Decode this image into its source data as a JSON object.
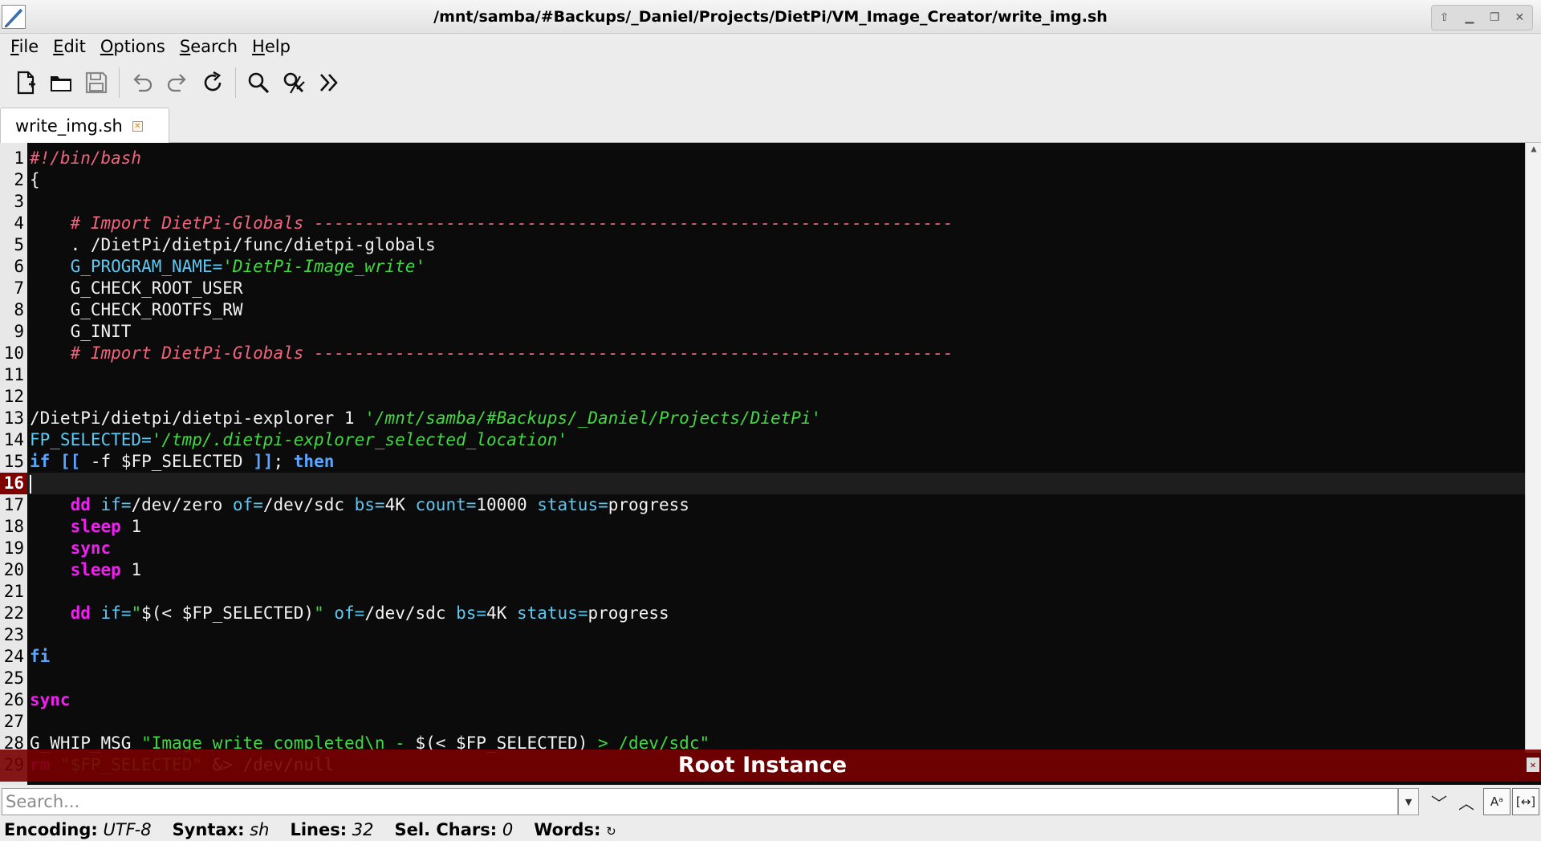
{
  "window": {
    "title": "/mnt/samba/#Backups/_Daniel/Projects/DietPi/VM_Image_Creator/write_img.sh",
    "controls": [
      "up-icon",
      "minimize-icon",
      "restore-icon",
      "close-icon"
    ]
  },
  "menu": [
    "File",
    "Edit",
    "Options",
    "Search",
    "Help"
  ],
  "toolbar": [
    "new-file-icon",
    "open-folder-icon",
    "save-icon",
    "undo-icon",
    "redo-icon",
    "reload-icon",
    "find-icon",
    "find-replace-icon",
    "goto-icon"
  ],
  "tab": {
    "label": "write_img.sh"
  },
  "editor": {
    "current_line": 16,
    "lines": [
      {
        "n": "1",
        "html": "<span class='cm'>#!/bin/bash</span>"
      },
      {
        "n": "2",
        "html": "{"
      },
      {
        "n": "3",
        "html": ""
      },
      {
        "n": "4",
        "html": "    <span class='cm'># Import DietPi-Globals ---------------------------------------------------------------</span>"
      },
      {
        "n": "5",
        "html": "    . /DietPi/dietpi/func/dietpi-globals"
      },
      {
        "n": "6",
        "html": "    <span class='vr'>G_PROGRAM_NAME=</span><span class='st'>'DietPi-Image_write'</span>"
      },
      {
        "n": "7",
        "html": "    G_CHECK_ROOT_USER"
      },
      {
        "n": "8",
        "html": "    G_CHECK_ROOTFS_RW"
      },
      {
        "n": "9",
        "html": "    G_INIT"
      },
      {
        "n": "10",
        "html": "    <span class='cm'># Import DietPi-Globals ---------------------------------------------------------------</span>"
      },
      {
        "n": "11",
        "html": ""
      },
      {
        "n": "12",
        "html": ""
      },
      {
        "n": "13",
        "html": "/DietPi/dietpi/dietpi-explorer 1 <span class='st'>'/mnt/samba/#Backups/_Daniel/Projects/DietPi'</span>"
      },
      {
        "n": "14",
        "html": "<span class='vr'>FP_SELECTED=</span><span class='st'>'/tmp/.dietpi-explorer_selected_location'</span>"
      },
      {
        "n": "15",
        "html": "<span class='kw'>if</span> <span class='kw'>[[</span> -f $FP_SELECTED <span class='kw'>]]</span>; <span class='kw'>then</span>"
      },
      {
        "n": "16",
        "html": "<span class='caret'></span>"
      },
      {
        "n": "17",
        "html": "    <span class='bi'>dd</span> <span class='vr'>if=</span>/dev/zero <span class='vr'>of=</span>/dev/sdc <span class='vr'>bs=</span>4K <span class='vr'>count=</span>10000 <span class='vr'>status=</span>progress"
      },
      {
        "n": "18",
        "html": "    <span class='bi'>sleep</span> 1"
      },
      {
        "n": "19",
        "html": "    <span class='bi'>sync</span>"
      },
      {
        "n": "20",
        "html": "    <span class='bi'>sleep</span> 1"
      },
      {
        "n": "21",
        "html": ""
      },
      {
        "n": "22",
        "html": "    <span class='bi'>dd</span> <span class='vr'>if=</span><span class='dq'>\"</span>$(&lt; $FP_SELECTED)<span class='dq'>\"</span> <span class='vr'>of=</span>/dev/sdc <span class='vr'>bs=</span>4K <span class='vr'>status=</span>progress"
      },
      {
        "n": "23",
        "html": ""
      },
      {
        "n": "24",
        "html": "<span class='kw'>fi</span>"
      },
      {
        "n": "25",
        "html": ""
      },
      {
        "n": "26",
        "html": "<span class='bi'>sync</span>"
      },
      {
        "n": "27",
        "html": ""
      },
      {
        "n": "28",
        "html": "G_WHIP_MSG <span class='dq'>\"Image write completed\\n - </span>$(&lt; $FP_SELECTED)<span class='dq'> &gt; /dev/sdc\"</span>"
      },
      {
        "n": "29",
        "html": "<span class='bi'>rm</span> <span class='dq'>\"$FP_SELECTED\"</span> &amp;&gt; /dev/null"
      }
    ]
  },
  "banner": {
    "text": "Root Instance"
  },
  "search": {
    "placeholder": "Search..."
  },
  "status": {
    "encoding_label": "Encoding:",
    "encoding_value": "UTF-8",
    "syntax_label": "Syntax:",
    "syntax_value": "sh",
    "lines_label": "Lines:",
    "lines_value": "32",
    "sel_label": "Sel. Chars:",
    "sel_value": "0",
    "words_label": "Words:",
    "words_icon": "refresh-icon"
  }
}
